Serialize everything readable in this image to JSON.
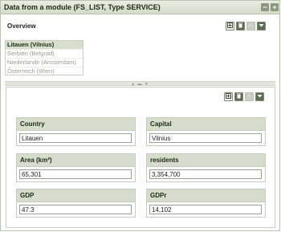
{
  "window": {
    "title": "Data from a module (FS_LIST, Type SERVICE)",
    "minimize_symbol": "−",
    "maximize_symbol": "+"
  },
  "overview": {
    "label": "Overview",
    "items": [
      "Litauen (Vilnius)",
      "Serbien (Belgrad)",
      "Niederlande (Amsterdam)",
      "Österreich (Wien)"
    ],
    "selected_index": 0
  },
  "toolbar_icons": {
    "new": "new-item-icon",
    "delete": "trash-icon",
    "disabled": "minus-icon",
    "menu": "chevron-down-icon"
  },
  "fields": {
    "country": {
      "label": "Country",
      "value": "Litauen"
    },
    "capital": {
      "label": "Capital",
      "value": "Vilnius"
    },
    "area": {
      "label": "Area (km²)",
      "value": "65,301"
    },
    "residents": {
      "label": "residents",
      "value": "3,354,700"
    },
    "gdp": {
      "label": "GDP",
      "value": "47.3"
    },
    "gdpr": {
      "label": "GDPr",
      "value": "14,102"
    }
  },
  "colors": {
    "titlebar": "#d3dbc8",
    "field_header": "#d6ddcd",
    "selected_row": "#d8dfcf"
  }
}
